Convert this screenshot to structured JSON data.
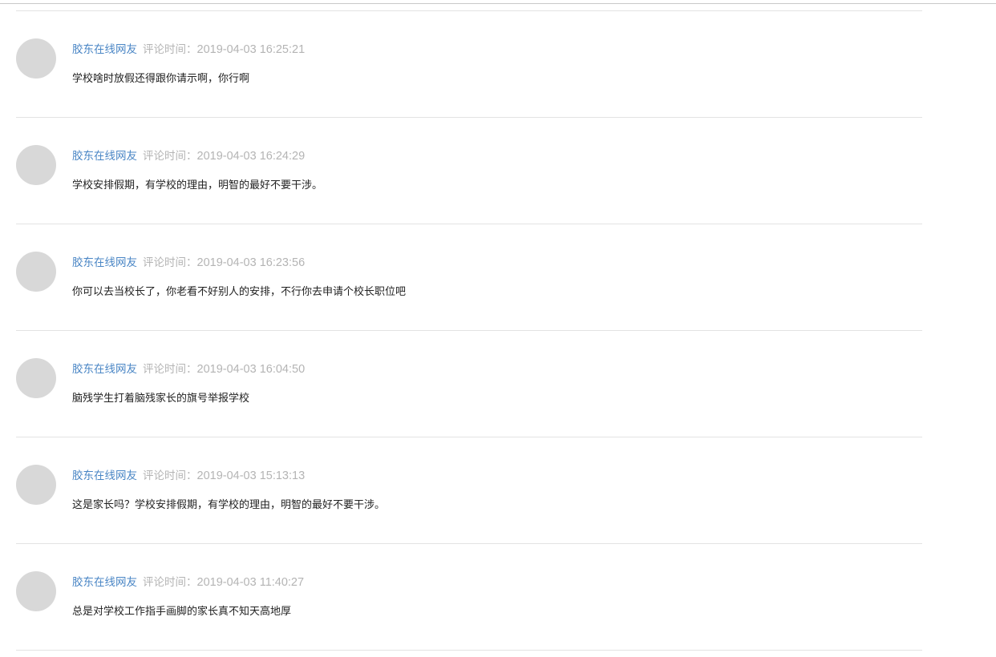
{
  "comments": [
    {
      "author": "胶东在线网友",
      "time_label": "评论时间：",
      "time": "2019-04-03 16:25:21",
      "text": "学校啥时放假还得跟你请示啊，你行啊"
    },
    {
      "author": "胶东在线网友",
      "time_label": "评论时间：",
      "time": "2019-04-03 16:24:29",
      "text": "学校安排假期，有学校的理由，明智的最好不要干涉。"
    },
    {
      "author": "胶东在线网友",
      "time_label": "评论时间：",
      "time": "2019-04-03 16:23:56",
      "text": "你可以去当校长了，你老看不好别人的安排，不行你去申请个校长职位吧"
    },
    {
      "author": "胶东在线网友",
      "time_label": "评论时间：",
      "time": "2019-04-03 16:04:50",
      "text": "脑残学生打着脑残家长的旗号举报学校"
    },
    {
      "author": "胶东在线网友",
      "time_label": "评论时间：",
      "time": "2019-04-03 15:13:13",
      "text": "这是家长吗？学校安排假期，有学校的理由，明智的最好不要干涉。"
    },
    {
      "author": "胶东在线网友",
      "time_label": "评论时间：",
      "time": "2019-04-03 11:40:27",
      "text": "总是对学校工作指手画脚的家长真不知天高地厚"
    }
  ]
}
